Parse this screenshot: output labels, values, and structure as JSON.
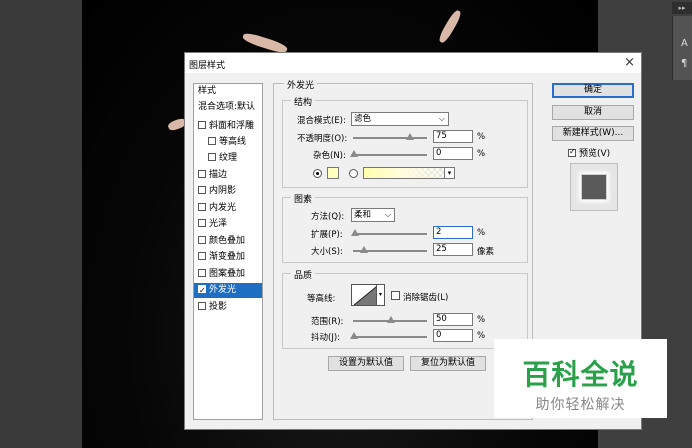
{
  "dialog": {
    "title": "图层样式",
    "close_glyph": "×"
  },
  "styles_panel": {
    "header": "样式",
    "blend_options": "混合选项:默认",
    "items": [
      {
        "label": "斜面和浮雕",
        "checked": false
      },
      {
        "label": "等高线",
        "checked": false
      },
      {
        "label": "纹理",
        "checked": false
      },
      {
        "label": "描边",
        "checked": false
      },
      {
        "label": "内阴影",
        "checked": false
      },
      {
        "label": "内发光",
        "checked": false
      },
      {
        "label": "光泽",
        "checked": false
      },
      {
        "label": "颜色叠加",
        "checked": false
      },
      {
        "label": "渐变叠加",
        "checked": false
      },
      {
        "label": "图案叠加",
        "checked": false
      },
      {
        "label": "外发光",
        "checked": true,
        "selected": true
      },
      {
        "label": "投影",
        "checked": false
      }
    ]
  },
  "outer_glow": {
    "section_title": "外发光",
    "structure": {
      "title": "结构",
      "blend_mode_label": "混合模式(E):",
      "blend_mode_value": "滤色",
      "opacity_label": "不透明度(O):",
      "opacity_value": "75",
      "opacity_unit": "%",
      "noise_label": "杂色(N):",
      "noise_value": "0",
      "noise_unit": "%",
      "solid_color": "#ffffc0"
    },
    "elements": {
      "title": "图素",
      "technique_label": "方法(Q):",
      "technique_value": "柔和",
      "spread_label": "扩展(P):",
      "spread_value": "2",
      "spread_unit": "%",
      "size_label": "大小(S):",
      "size_value": "25",
      "size_unit": "像素"
    },
    "quality": {
      "title": "品质",
      "contour_label": "等高线:",
      "antialias_label": "消除锯齿(L)",
      "range_label": "范围(R):",
      "range_value": "50",
      "range_unit": "%",
      "jitter_label": "抖动(J):",
      "jitter_value": "0",
      "jitter_unit": "%"
    },
    "make_default_button": "设置为默认值",
    "reset_default_button": "复位为默认值"
  },
  "actions": {
    "ok": "确定",
    "cancel": "取消",
    "new_style": "新建样式(W)...",
    "preview_label": "预览(V)",
    "preview_checked": true
  },
  "watermark": {
    "main": "百科全说",
    "sub": "助你轻松解决",
    "color": "#2aa04a"
  },
  "workspace": {
    "panel_letter": "A",
    "panel_glyph": "¶"
  }
}
